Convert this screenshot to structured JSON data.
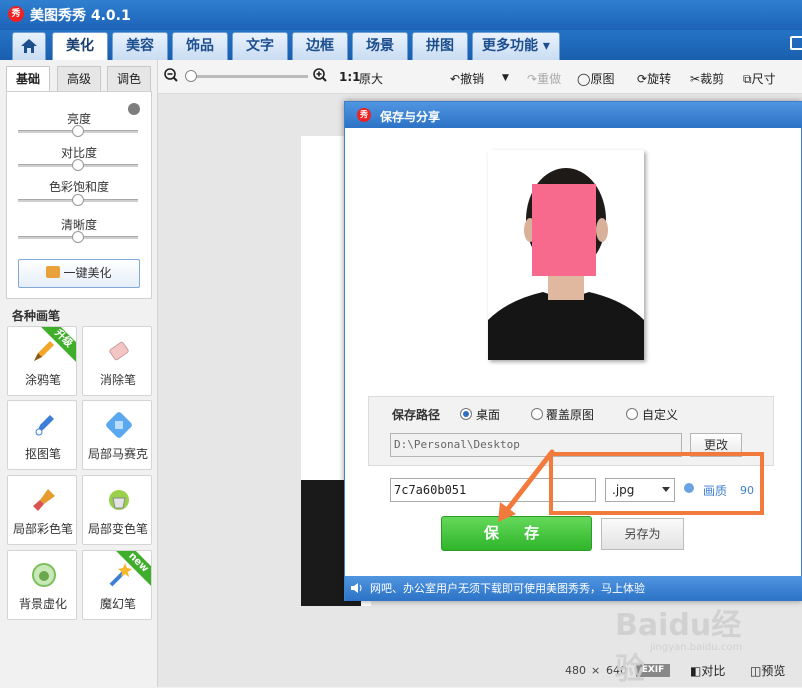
{
  "app": {
    "title": "美图秀秀 4.0.1",
    "logo_text": "秀"
  },
  "tabs": [
    {
      "label": "美化"
    },
    {
      "label": "美容"
    },
    {
      "label": "饰品"
    },
    {
      "label": "文字"
    },
    {
      "label": "边框"
    },
    {
      "label": "场景"
    },
    {
      "label": "拼图"
    },
    {
      "label": "更多功能 ▾"
    }
  ],
  "toolbar": {
    "ratio": "1:1",
    "original_size": "原大",
    "undo": "撤销",
    "redo": "重做",
    "original": "原图",
    "rotate": "旋转",
    "crop": "裁剪",
    "size": "尺寸"
  },
  "left_panel": {
    "subtabs": [
      "基础",
      "高级",
      "调色"
    ],
    "sliders": [
      "亮度",
      "对比度",
      "色彩饱和度",
      "清晰度"
    ],
    "one_key": "一键美化",
    "brushes_title": "各种画笔",
    "brushes": [
      {
        "label": "涂鸦笔",
        "badge": "升级"
      },
      {
        "label": "消除笔"
      },
      {
        "label": "抠图笔"
      },
      {
        "label": "局部马赛克"
      },
      {
        "label": "局部彩色笔"
      },
      {
        "label": "局部变色笔"
      },
      {
        "label": "背景虚化"
      },
      {
        "label": "魔幻笔",
        "badge": "new"
      }
    ]
  },
  "dialog": {
    "title": "保存与分享",
    "logo_text": "秀",
    "path_label": "保存路径",
    "radio_options": [
      "桌面",
      "覆盖原图",
      "自定义"
    ],
    "selected_option": "桌面",
    "path_value": "D:\\Personal\\Desktop",
    "change_button": "更改",
    "filename": "7c7a60b051",
    "format": ".jpg",
    "quality_label": "画质",
    "quality_value": "90",
    "save_button": "保 存",
    "save_as_button": "另存为",
    "footer_text": "网吧、办公室用户无须下载即可使用美图秀秀，马上体验"
  },
  "status": {
    "width": "480",
    "times": "×",
    "height": "640",
    "exif": "EXIF",
    "compare": "对比",
    "preview": "预览"
  },
  "watermark": {
    "text": "Baidu经验",
    "sub": "jingyan.baidu.com"
  },
  "colors": {
    "brand_blue": "#2d73c6",
    "save_green": "#2fb52b",
    "annotation_orange": "#f27a3c",
    "face_pink": "#f76a8d"
  }
}
